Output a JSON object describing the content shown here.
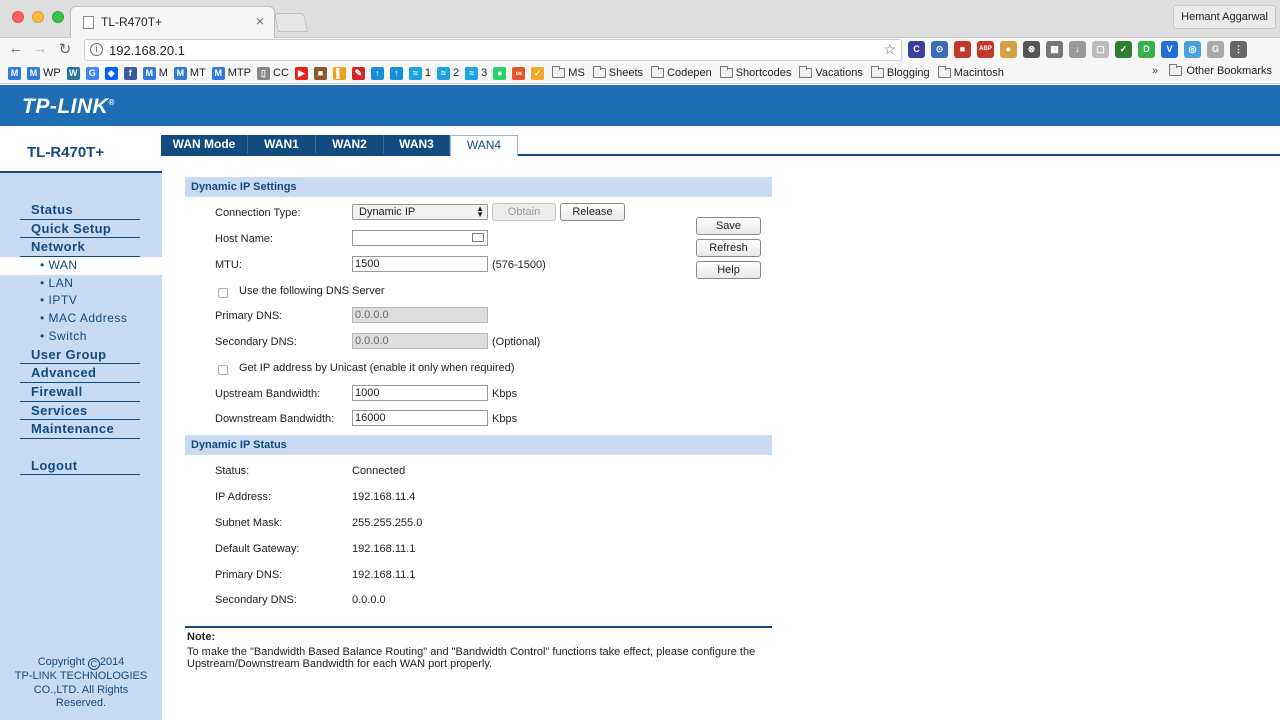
{
  "browser": {
    "tab_title": "TL-R470T+",
    "tab_close": "×",
    "user": "Hemant Aggarwal",
    "url": "192.168.20.1",
    "back": "←",
    "forward": "→",
    "reload": "↻",
    "star": "☆",
    "bookmarks": [
      {
        "label": "",
        "icon": "M",
        "color": "#2d7bd6"
      },
      {
        "label": "WP",
        "icon": "M",
        "color": "#2d7bd6"
      },
      {
        "label": "",
        "icon": "W",
        "color": "#21759b"
      },
      {
        "label": "",
        "icon": "G",
        "color": "#4285f4"
      },
      {
        "label": "",
        "icon": "◆",
        "color": "#0061fe"
      },
      {
        "label": "",
        "icon": "f",
        "color": "#3b5998"
      },
      {
        "label": "M",
        "icon": "M",
        "color": "#2d7bd6"
      },
      {
        "label": "MT",
        "icon": "M",
        "color": "#2d7bd6"
      },
      {
        "label": "MTP",
        "icon": "M",
        "color": "#2d7bd6"
      },
      {
        "label": "CC",
        "icon": "▯",
        "color": "#888888"
      },
      {
        "label": "",
        "icon": "▶",
        "color": "#e62117"
      },
      {
        "label": "",
        "icon": "■",
        "color": "#8a5a2b"
      },
      {
        "label": "",
        "icon": "▌",
        "color": "#e8a21e"
      },
      {
        "label": "",
        "icon": "✎",
        "color": "#d12727"
      },
      {
        "label": "",
        "icon": "↑",
        "color": "#1a8fd8"
      },
      {
        "label": "",
        "icon": "↑",
        "color": "#1a8fd8"
      },
      {
        "label": "1",
        "icon": "≈",
        "color": "#1aa3e0"
      },
      {
        "label": "2",
        "icon": "≈",
        "color": "#1aa3e0"
      },
      {
        "label": "3",
        "icon": "≈",
        "color": "#1aa3e0"
      },
      {
        "label": "",
        "icon": "●",
        "color": "#25d366"
      },
      {
        "label": "",
        "icon": "∞",
        "color": "#e8542c"
      },
      {
        "label": "",
        "icon": "✓",
        "color": "#f5a623"
      }
    ],
    "folders": [
      "MS",
      "Sheets",
      "Codepen",
      "Shortcodes",
      "Vacations",
      "Blogging",
      "Macintosh"
    ],
    "overflow": "»",
    "other_bookmarks": "Other Bookmarks",
    "extensions": [
      {
        "icon": "C",
        "color": "#3a3f9e"
      },
      {
        "icon": "⊙",
        "color": "#3f6db5"
      },
      {
        "icon": "■",
        "color": "#c0392b"
      },
      {
        "icon": "ABP",
        "color": "#c0392b"
      },
      {
        "icon": "●",
        "color": "#d4a14b"
      },
      {
        "icon": "⊗",
        "color": "#555555"
      },
      {
        "icon": "▦",
        "color": "#777777"
      },
      {
        "icon": "↓",
        "color": "#999999"
      },
      {
        "icon": "▢",
        "color": "#bbbbbb"
      },
      {
        "icon": "✓",
        "color": "#2e7d32"
      },
      {
        "icon": "D",
        "color": "#33b249"
      },
      {
        "icon": "V",
        "color": "#1e6fd9"
      },
      {
        "icon": "◎",
        "color": "#4aa3df"
      },
      {
        "icon": "G",
        "color": "#aaaaaa"
      },
      {
        "icon": "⋮",
        "color": "#666666"
      }
    ]
  },
  "router": {
    "logo": "TP-LINK",
    "logo_mark": "®",
    "model": "TL-R470T+",
    "tabs": [
      "WAN Mode",
      "WAN1",
      "WAN2",
      "WAN3",
      "WAN4"
    ],
    "active_tab": "WAN4",
    "menu": {
      "status": "Status",
      "quick_setup": "Quick Setup",
      "network": "Network",
      "wan": "• WAN",
      "lan": "• LAN",
      "iptv": "• IPTV",
      "mac": "• MAC Address",
      "switch": "• Switch",
      "user_group": "User Group",
      "advanced": "Advanced",
      "firewall": "Firewall",
      "services": "Services",
      "maintenance": "Maintenance",
      "logout": "Logout"
    },
    "copyright": {
      "line1_pre": "Copyright",
      "symbol": "C",
      "line1_post": "2014",
      "line2": "TP-LINK TECHNOLOGIES",
      "line3": "CO.,LTD. All Rights",
      "line4": "Reserved."
    },
    "settings": {
      "title": "Dynamic IP Settings",
      "connection_type_label": "Connection Type:",
      "connection_type_value": "Dynamic IP",
      "obtain": "Obtain",
      "release": "Release",
      "host_name_label": "Host Name:",
      "host_name_value": "",
      "mtu_label": "MTU:",
      "mtu_value": "1500",
      "mtu_hint": "(576-1500)",
      "use_dns_label": "Use the following DNS Server",
      "primary_dns_label": "Primary DNS:",
      "primary_dns_value": "0.0.0.0",
      "secondary_dns_label": "Secondary DNS:",
      "secondary_dns_value": "0.0.0.0",
      "secondary_dns_hint": "(Optional)",
      "unicast_label": "Get IP address by Unicast (enable it only when required)",
      "upstream_label": "Upstream Bandwidth:",
      "upstream_value": "1000",
      "upstream_unit": "Kbps",
      "downstream_label": "Downstream Bandwidth:",
      "downstream_value": "16000",
      "downstream_unit": "Kbps"
    },
    "buttons": {
      "save": "Save",
      "refresh": "Refresh",
      "help": "Help"
    },
    "status": {
      "title": "Dynamic IP Status",
      "rows": [
        {
          "label": "Status:",
          "value": "Connected"
        },
        {
          "label": "IP Address:",
          "value": "192.168.11.4"
        },
        {
          "label": "Subnet Mask:",
          "value": "255.255.255.0"
        },
        {
          "label": "Default Gateway:",
          "value": "192.168.11.1"
        },
        {
          "label": "Primary DNS:",
          "value": "192.168.11.1"
        },
        {
          "label": "Secondary DNS:",
          "value": "0.0.0.0"
        }
      ]
    },
    "note": {
      "title": "Note:",
      "text": "To make the \"Bandwidth Based Balance Routing\" and \"Bandwidth Control\" functions take effect, please configure the Upstream/Downstream Bandwidth for each WAN port properly."
    }
  }
}
